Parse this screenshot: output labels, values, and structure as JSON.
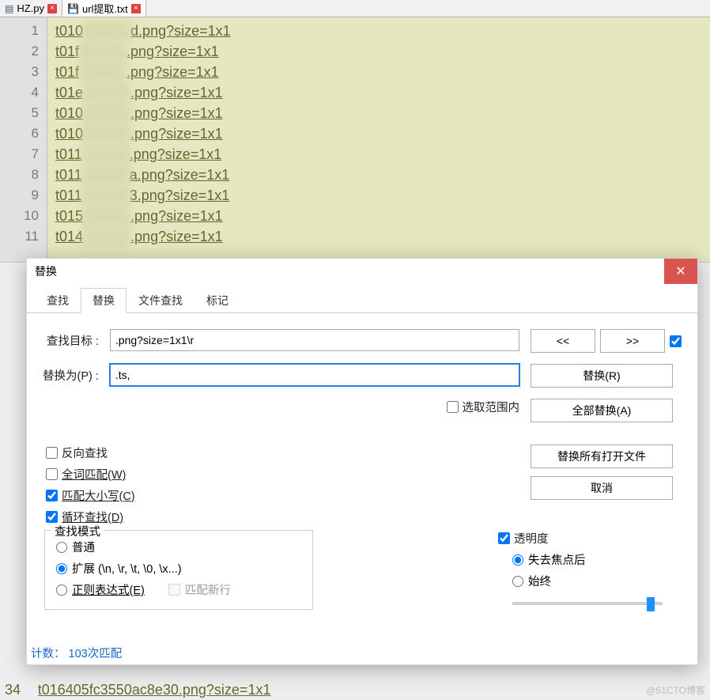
{
  "tabs": {
    "items": [
      {
        "label": "HZ.py",
        "icon": "disk"
      },
      {
        "label": "url提取.txt",
        "icon": "save",
        "active": true
      }
    ]
  },
  "editor": {
    "lines": [
      {
        "num": 1,
        "prefix": "t010",
        "mid": "fb",
        "tail": "d.png?size=1x1"
      },
      {
        "num": 2,
        "prefix": "t01f",
        "mid": "24",
        "tail": ".png?size=1x1"
      },
      {
        "num": 3,
        "prefix": "t01f",
        "mid": "d8",
        "tail": ".png?size=1x1"
      },
      {
        "num": 4,
        "prefix": "t01e",
        "mid": "cb",
        "tail": ".png?size=1x1"
      },
      {
        "num": 5,
        "prefix": "t010",
        "mid": "82",
        "tail": ".png?size=1x1"
      },
      {
        "num": 6,
        "prefix": "t010",
        "mid": "b9",
        "tail": ".png?size=1x1"
      },
      {
        "num": 7,
        "prefix": "t011",
        "mid": "b88",
        "tail": ".png?size=1x1"
      },
      {
        "num": 8,
        "prefix": "t011",
        "mid": "6f1",
        "tail": "a.png?size=1x1"
      },
      {
        "num": 9,
        "prefix": "t011",
        "mid": "c73",
        "tail": "3.png?size=1x1"
      },
      {
        "num": 10,
        "prefix": "t015",
        "mid": "663",
        "tail": ".png?size=1x1"
      },
      {
        "num": 11,
        "prefix": "t014",
        "mid": "20",
        "tail": ".png?size=1x1"
      }
    ]
  },
  "dialog": {
    "title": "替换",
    "tabs": {
      "find": "查找",
      "replace": "替换",
      "findfiles": "文件查找",
      "mark": "标记"
    },
    "labels": {
      "find_target": "查找目标 :",
      "replace_with": "替换为(P) :"
    },
    "values": {
      "find_target": ".png?size=1x1\\r",
      "replace_with": ".ts,"
    },
    "checks": {
      "in_selection": "选取范围内",
      "backward": "反向查找",
      "whole_word": "全词匹配(W)",
      "match_case": "匹配大小写(C)",
      "wrap": "循环查找(D)",
      "match_newline": "匹配新行",
      "transparency": "透明度"
    },
    "buttons": {
      "prev": "<<",
      "next": ">>",
      "replace": "替换(R)",
      "replace_all": "全部替换(A)",
      "replace_all_open": "替换所有打开文件",
      "cancel": "取消"
    },
    "searchmode": {
      "legend": "查找模式",
      "normal": "普通",
      "extended": "扩展 (\\n, \\r, \\t, \\0, \\x...)",
      "regex": "正则表达式(E)"
    },
    "transparency_opts": {
      "onlosefocus": "失去焦点后",
      "always": "始终"
    },
    "status": "计数： 103次匹配"
  },
  "bottom": {
    "lineno": "34",
    "text": "t016405fc3550ac8e30.png?size=1x1"
  },
  "watermark": "@51CTO博客"
}
